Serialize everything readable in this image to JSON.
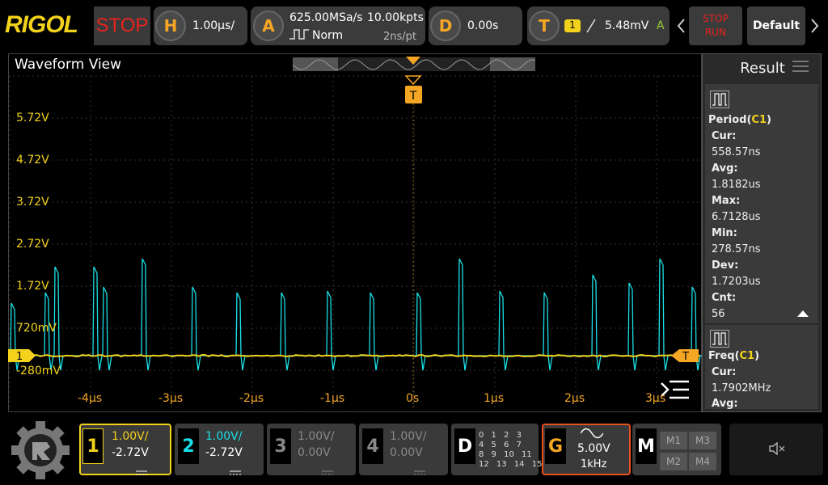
{
  "brand": "RIGOL",
  "run_state": "STOP",
  "horizontal": {
    "icon": "H",
    "value": "1.00µs/"
  },
  "acquire": {
    "icon": "A",
    "rate": "625.00MSa/s",
    "points": "10.00kpts",
    "mode": "Norm",
    "time_per_pt": "2ns/pt"
  },
  "delay": {
    "icon": "D",
    "value": "0.00s"
  },
  "trigger": {
    "icon": "T",
    "channel": "1",
    "level": "5.48mV",
    "auto": "A"
  },
  "stop_run": {
    "stop": "STOP",
    "run": "RUN"
  },
  "default_btn": "Default",
  "waveform": {
    "title": "Waveform View",
    "trigger_marker": "T",
    "ch1_marker": "1",
    "right_marker": "T",
    "y_labels": [
      "5.72V",
      "4.72V",
      "3.72V",
      "2.72V",
      "1.72V",
      "720mV",
      "-280mV"
    ],
    "x_labels": [
      "-4µs",
      "-3µs",
      "-2µs",
      "-1µs",
      "0s",
      "1µs",
      "2µs",
      "3µs"
    ]
  },
  "result": {
    "title": "Result",
    "m1": {
      "name": "Period",
      "src": "C1",
      "rows": [
        {
          "k": "Cur:",
          "v": "558.57ns"
        },
        {
          "k": "Avg:",
          "v": "1.8182us"
        },
        {
          "k": "Max:",
          "v": "6.7128us"
        },
        {
          "k": "Min:",
          "v": "278.57ns"
        },
        {
          "k": "Dev:",
          "v": "1.7203us"
        },
        {
          "k": "Cnt:",
          "v": "56"
        }
      ]
    },
    "m2": {
      "name": "Freq",
      "src": "C1",
      "rows": [
        {
          "k": "Cur:",
          "v": "1.7902MHz"
        },
        {
          "k": "Avg:",
          "v": ""
        }
      ]
    }
  },
  "channels": [
    {
      "num": "1",
      "scale": "1.00V/",
      "offset": "-2.72V",
      "color": "#f2d21b",
      "active": true
    },
    {
      "num": "2",
      "scale": "1.00V/",
      "offset": "-2.72V",
      "color": "#19e0e6",
      "active": true
    },
    {
      "num": "3",
      "scale": "1.00V/",
      "offset": "0.00V",
      "color": "#888888",
      "active": false
    },
    {
      "num": "4",
      "scale": "1.00V/",
      "offset": "0.00V",
      "color": "#888888",
      "active": false
    }
  ],
  "digital": {
    "label": "D",
    "rows": [
      "0 1 2 3",
      "4 5 6 7",
      "8 9 10 11",
      "12 13 14 15"
    ]
  },
  "generator": {
    "label": "G",
    "amp": "5.00V",
    "freq": "1kHz"
  },
  "math": {
    "label": "M",
    "items": [
      "M1",
      "M3",
      "M2",
      "M4"
    ]
  },
  "colors": {
    "ch1": "#f2d21b",
    "ch2": "#19e0e6",
    "trigger": "#f5a623",
    "stop": "#e8231e"
  }
}
